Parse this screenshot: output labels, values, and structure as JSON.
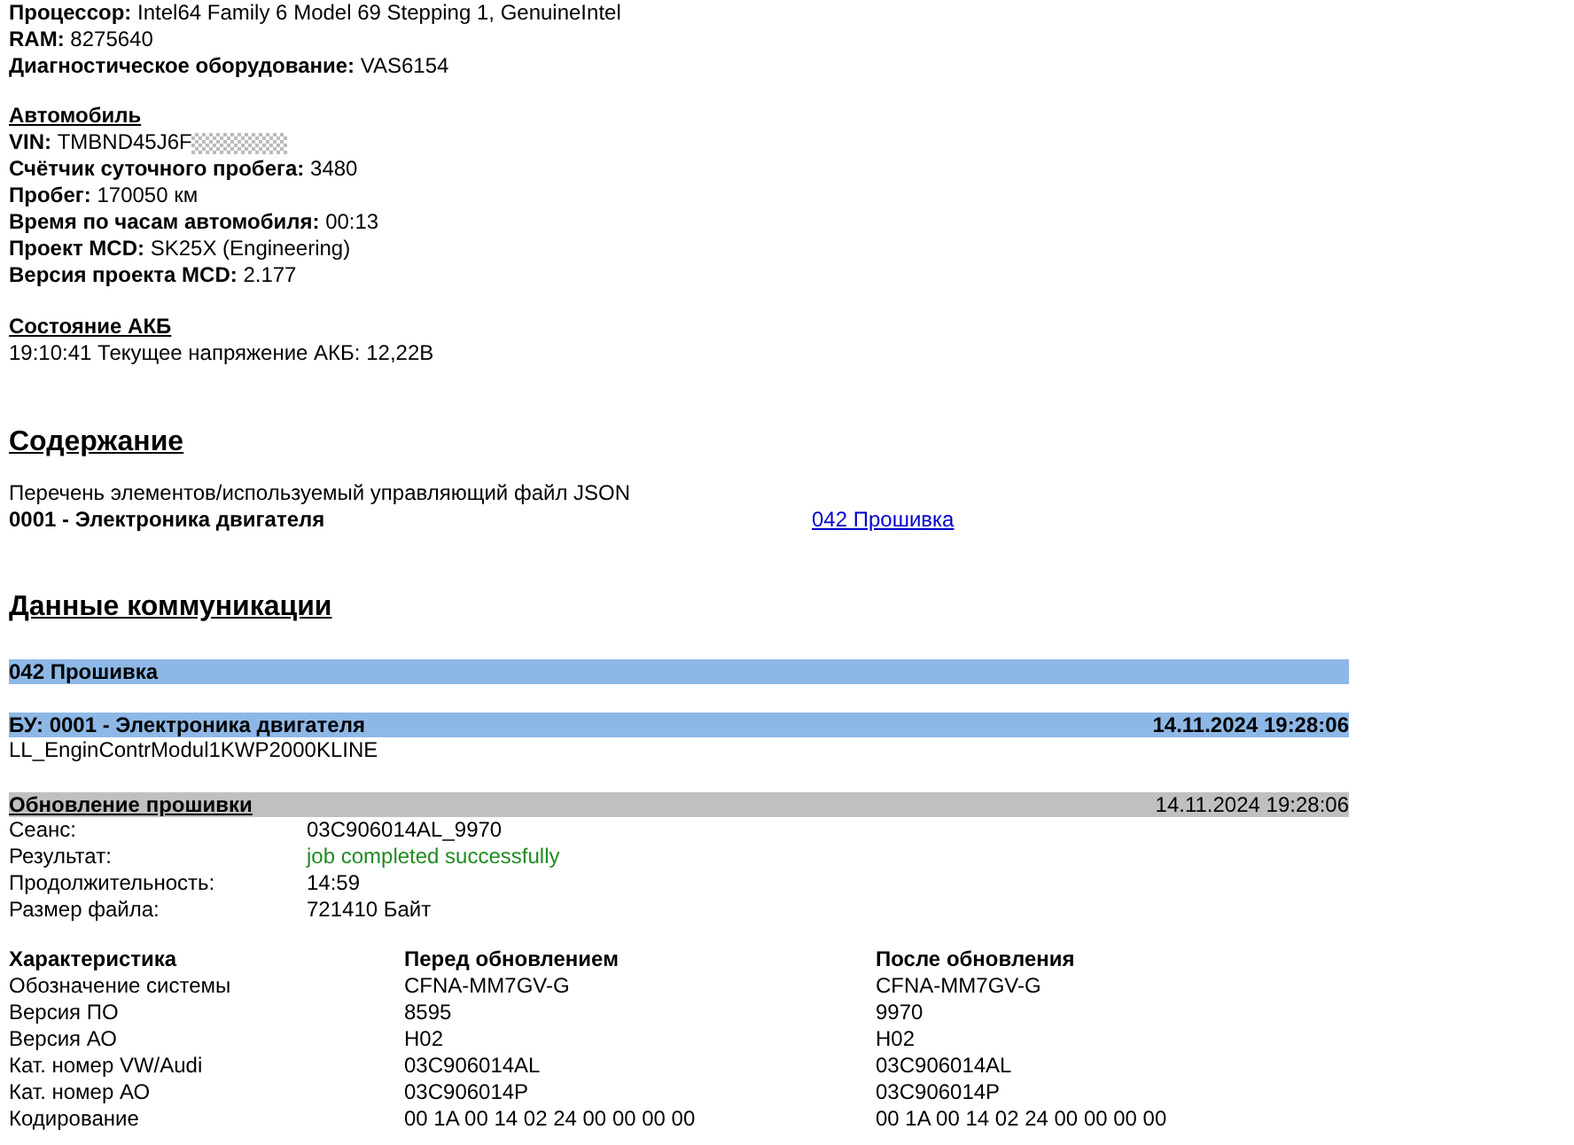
{
  "system": [
    {
      "label": "Процессор:",
      "value": "Intel64 Family 6 Model 69 Stepping 1, GenuineIntel"
    },
    {
      "label": "RAM:",
      "value": "8275640"
    },
    {
      "label": "Диагностическое оборудование:",
      "value": "VAS6154"
    }
  ],
  "vehicle": {
    "title": "Автомобиль",
    "fields": [
      {
        "label": "VIN:",
        "value": "TMBND45J6F",
        "redacted": true
      },
      {
        "label": "Счётчик суточного пробега:",
        "value": "3480",
        "redacted": false
      },
      {
        "label": "Пробег:",
        "value": "170050 км",
        "redacted": false
      },
      {
        "label": "Время по часам автомобиля:",
        "value": "00:13",
        "redacted": false
      },
      {
        "label": "Проект MCD:",
        "value": "SK25X (Engineering)",
        "redacted": false
      },
      {
        "label": "Версия проекта MCD:",
        "value": "2.177",
        "redacted": false
      }
    ]
  },
  "battery": {
    "title": "Состояние АКБ",
    "line": "19:10:41 Текущее напряжение АКБ: 12,22В"
  },
  "contents": {
    "title": "Содержание",
    "intro": "Перечень элементов/используемый управляющий файл JSON",
    "items": [
      {
        "name": "0001 - Электроника двигателя",
        "link": "042 Прошивка"
      }
    ]
  },
  "communication": {
    "title": "Данные коммуникации",
    "section_bar": "042 Прошивка",
    "ecu": {
      "title": "БУ: 0001 - Электроника двигателя",
      "timestamp": "14.11.2024 19:28:06",
      "module": "LL_EnginContrModul1KWP2000KLINE"
    },
    "update": {
      "title": "Обновление прошивки",
      "timestamp": "14.11.2024 19:28:06",
      "fields": [
        {
          "label": "Сеанс:",
          "value": "03C906014AL_9970",
          "color": "#000000"
        },
        {
          "label": "Результат:",
          "value": "job completed successfully",
          "color": "#228b22"
        },
        {
          "label": "Продолжительность:",
          "value": "14:59",
          "color": "#000000"
        },
        {
          "label": "Размер файла:",
          "value": "721410 Байт",
          "color": "#000000"
        }
      ]
    },
    "table": {
      "columns": [
        "Характеристика",
        "Перед обновлением",
        "После обновления"
      ],
      "rows": [
        [
          "Обозначение системы",
          "CFNA-MM7GV-G",
          "CFNA-MM7GV-G"
        ],
        [
          "Версия ПО",
          "8595",
          "9970"
        ],
        [
          "Версия АО",
          "H02",
          "H02"
        ],
        [
          "Кат. номер VW/Audi",
          "03C906014AL",
          "03C906014AL"
        ],
        [
          "Кат. номер АО",
          "03C906014P",
          "03C906014P"
        ],
        [
          "Кодирование",
          "00 1A 00 14 02 24 00 00 00 00",
          "00 1A 00 14 02 24 00 00 00 00"
        ]
      ]
    }
  }
}
